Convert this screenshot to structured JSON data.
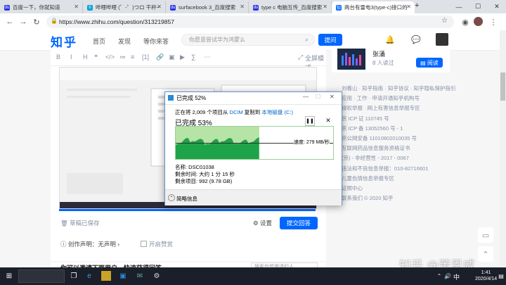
{
  "browser": {
    "tabs": [
      {
        "title": "百度一下，你就知道",
        "fav": "du",
        "fav_color": "#2932e1",
        "x": 0
      },
      {
        "title": "哔哩哔哩 (゜-゜)つロ 干杯~",
        "fav": "b",
        "fav_color": "#00a1d6",
        "x": 1
      },
      {
        "title": "surfacebook 3_百度搜索",
        "fav": "du",
        "fav_color": "#2932e1",
        "x": 2
      },
      {
        "title": "type c 电脑互传_百度搜索",
        "fav": "du",
        "fav_color": "#2932e1",
        "x": 3
      },
      {
        "title": "两台有雷电3(type-c)接口的",
        "fav": "知",
        "fav_color": "#0066ff",
        "x": 4
      }
    ],
    "new_tab": "+",
    "url": "https://www.zhihu.com/question/313219857"
  },
  "zhihu": {
    "logo": "知乎",
    "nav": [
      "首页",
      "发现",
      "等你来答"
    ],
    "search_placeholder": "你愿意尝试华为鸿蒙么",
    "ask_label": "提问"
  },
  "editor": {
    "toolbar": [
      "B",
      "I",
      "H",
      "❝",
      "</>",
      "≔",
      "≡",
      "[1]",
      "🔗",
      "▣",
      "▶",
      "∑",
      "⋯",
      "⤢",
      "全屏模式"
    ],
    "draft_status": "草稿已保存",
    "settings_label": "设置",
    "submit_label": "提交回答",
    "declaration": "创作声明：无声明",
    "preview_label": "开启赞赏",
    "invite_title": "你可以邀请下面用户，快速获得回答",
    "invite_search": "搜索你想邀请的人"
  },
  "sidebar": {
    "author": "张涌",
    "readers": "8 人读过",
    "read_button": "阅读",
    "footer_lines": [
      "刘看山 · 知乎指南 · 知乎协议 · 知乎隐私保护指引",
      "应用 · 工作 · 申请开通知乎机构号",
      "侵权举报 · 网上有害信息举报专区",
      "京 ICP 证 110745 号",
      "京 ICP 备 13052560 号 - 1",
      "京公网安备 11010802010035 号",
      "互联网药品信息服务资格证书",
      "(京) - 非经营性 - 2017 - 0067",
      "违法和不良信息举报：010-82716601",
      "儿童色情信息举报专区",
      "证照中心",
      "联系我们 © 2020 知乎"
    ]
  },
  "copy_dialog": {
    "title": "已完成 52%",
    "line_prefix": "正在将 2,009 个项目从 ",
    "source": "DCIM",
    "line_mid": " 复制到 ",
    "destination": "本地磁盘 (C:)",
    "percent_text": "已完成 53%",
    "progress": 0.53,
    "speed": "速度: 279 MB/秒",
    "name": "名称: DSC01038",
    "time_left": "剩余时间: 大约 1 分 15 秒",
    "items_left": "剩余项目: 992 (9.78 GB)",
    "less_info": "简略信息"
  },
  "watermark": "知乎 @董恩威",
  "taskbar": {
    "lang": "中",
    "time": "1:41",
    "date": "2020/4/14"
  }
}
